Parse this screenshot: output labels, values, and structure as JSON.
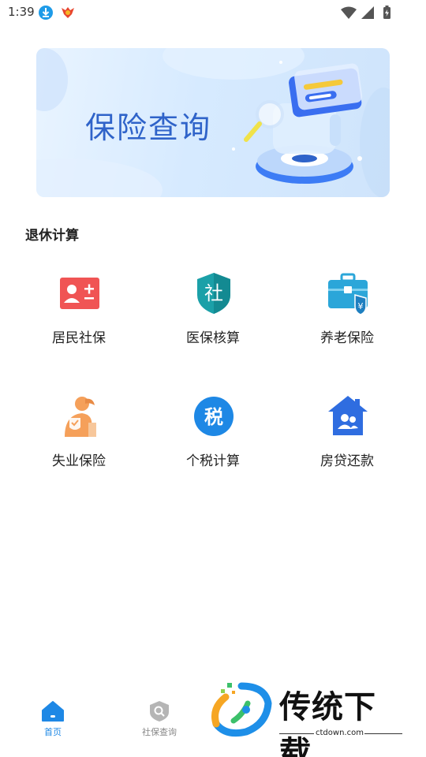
{
  "status_bar": {
    "time": "1:39"
  },
  "banner": {
    "title": "保险查询"
  },
  "section": {
    "title": "退休计算"
  },
  "grid": {
    "items": [
      {
        "label": "居民社保",
        "icon": "resident-id-card-icon",
        "color": "#f05454"
      },
      {
        "label": "医保核算",
        "icon": "shield-she-icon",
        "color": "#1ba0a8"
      },
      {
        "label": "养老保险",
        "icon": "briefcase-yuan-icon",
        "color": "#2ba6d9"
      },
      {
        "label": "失业保险",
        "icon": "elderly-person-icon",
        "color": "#f5a05a"
      },
      {
        "label": "个税计算",
        "icon": "tax-circle-icon",
        "color": "#1e88e5",
        "glyph": "税"
      },
      {
        "label": "房贷还款",
        "icon": "house-people-icon",
        "color": "#2f6de0"
      }
    ]
  },
  "shield_glyph": "社",
  "bottom_nav": {
    "items": [
      {
        "label": "首页",
        "icon": "home-icon",
        "active": true,
        "color": "#1e88e5"
      },
      {
        "label": "社保查询",
        "icon": "search-shield-icon",
        "active": false,
        "color": "#888888"
      }
    ]
  },
  "watermark": {
    "text": "传统下载",
    "url": "ctdown.com"
  }
}
